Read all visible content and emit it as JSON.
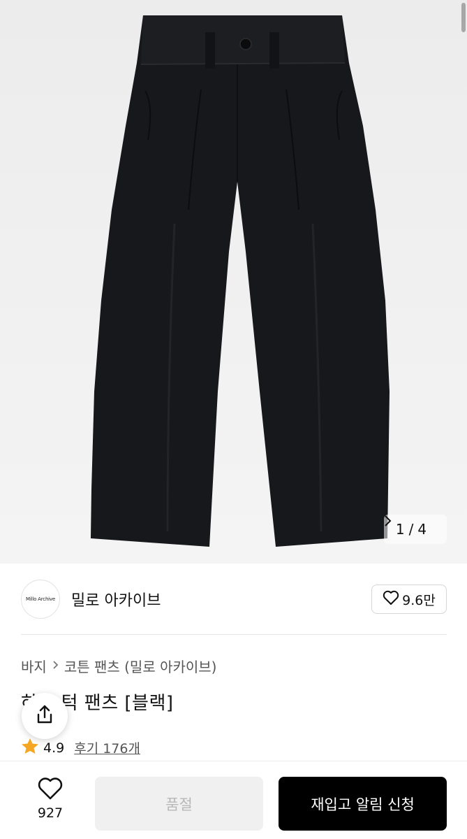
{
  "gallery": {
    "current": "1",
    "separator": "/",
    "total": "4",
    "next_icon": "chevron-right-icon"
  },
  "brand": {
    "logo_text": "Millo Archive",
    "name": "밀로 아카이브",
    "likes": "9.6만"
  },
  "breadcrumb": {
    "items": [
      "바지",
      "코튼 팬츠 (밀로 아카이브)"
    ]
  },
  "product": {
    "title": "하우 턱 팬츠 [블랙]"
  },
  "rating": {
    "score": "4.9",
    "reviews": "후기 176개"
  },
  "bottom_bar": {
    "wish_count": "927",
    "soldout_label": "품절",
    "restock_label": "재입고 알림 신청"
  },
  "colors": {
    "accent_star": "#f5a623",
    "primary_button": "#000000",
    "disabled_button": "#f0f0f0"
  }
}
